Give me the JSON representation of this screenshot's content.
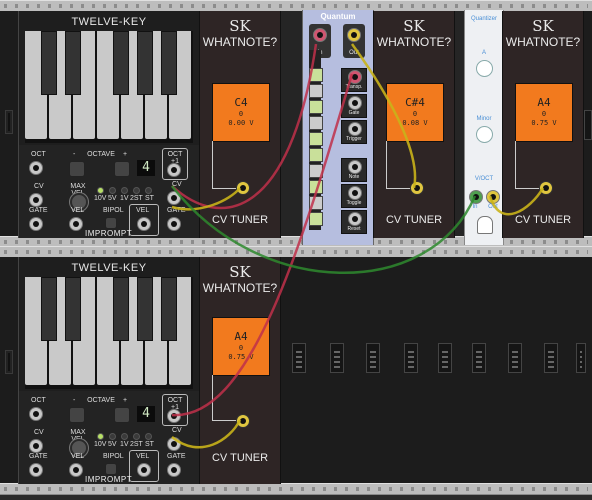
{
  "twelve_key_top": {
    "title": "TWELVE-KEY",
    "oct_label": "OCT",
    "octave_label": "OCTAVE",
    "minus": "-",
    "plus": "+",
    "display": "4",
    "oct_plus_label": "OCT +1",
    "cv_label": "CV",
    "max_vel_label": "MAX VEL",
    "range_labels": [
      "10V",
      "5V",
      "1V",
      "2ST",
      "ST"
    ],
    "cv_label_right": "CV",
    "gate_label": "GATE",
    "vel_label": "VEL",
    "bipol_label": "BIPOL",
    "vel_box_label": "VEL",
    "gate_label_right": "GATE",
    "brand": "IMPROMPT"
  },
  "twelve_key_bottom": {
    "title": "TWELVE-KEY",
    "oct_label": "OCT",
    "octave_label": "OCTAVE",
    "minus": "-",
    "plus": "+",
    "display": "4",
    "oct_plus_label": "OCT +1",
    "cv_label": "CV",
    "max_vel_label": "MAX VEL",
    "range_labels": [
      "10V",
      "5V",
      "1V",
      "2ST",
      "ST"
    ],
    "cv_label_right": "CV",
    "gate_label": "GATE",
    "vel_label": "VEL",
    "bipol_label": "BIPOL",
    "vel_box_label": "VEL",
    "gate_label_right": "GATE",
    "brand": "IMPROMPT"
  },
  "whatnote_1": {
    "brand": "SK",
    "title": "WHATNOTE?",
    "note": "C4",
    "octave": "0",
    "voltage": "0.00 V",
    "footer": "CV TUNER"
  },
  "whatnote_2": {
    "brand": "SK",
    "title": "WHATNOTE?",
    "note": "C#4",
    "octave": "0",
    "voltage": "0.08 V",
    "footer": "CV TUNER"
  },
  "whatnote_3": {
    "brand": "SK",
    "title": "WHATNOTE?",
    "note": "A4",
    "octave": "0",
    "voltage": "0.75 V",
    "footer": "CV TUNER"
  },
  "whatnote_4": {
    "brand": "SK",
    "title": "WHATNOTE?",
    "note": "A4",
    "octave": "0",
    "voltage": "0.75 V",
    "footer": "CV TUNER"
  },
  "quantum": {
    "title": "Quantum",
    "in_label": "In",
    "out_label": "Out",
    "rows": [
      "Transp.",
      "Gate",
      "Trigger",
      "Note",
      "Toggle",
      "Reset"
    ]
  },
  "quantizer": {
    "title": "Quantizer",
    "knob_a_label": "A",
    "scale_label": "Minor",
    "voct_label": "V/OCT",
    "in_label": "In",
    "out_label": "Out"
  },
  "colors": {
    "cable_red": "#c0304a",
    "cable_yellow": "#c9b21a",
    "cable_green": "#2e8a2e",
    "screen": "#f27a1e"
  }
}
